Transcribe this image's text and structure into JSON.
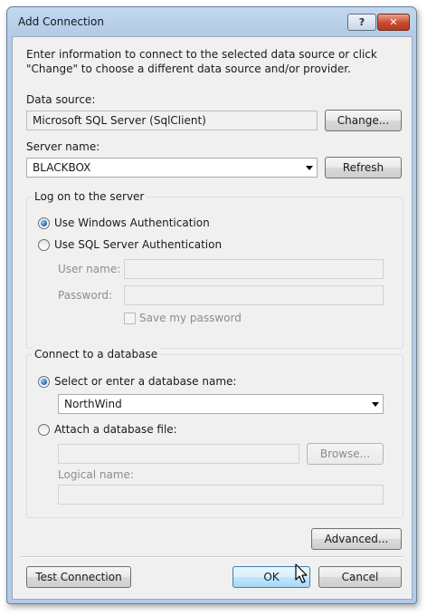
{
  "window": {
    "title": "Add Connection",
    "help_glyph": "?",
    "close_glyph": "✕"
  },
  "intro": "Enter information to connect to the selected data source or click \"Change\" to choose a different data source and/or provider.",
  "data_source": {
    "label": "Data source:",
    "value": "Microsoft SQL Server (SqlClient)",
    "change_button": "Change..."
  },
  "server": {
    "label": "Server name:",
    "value": "BLACKBOX",
    "refresh_button": "Refresh"
  },
  "logon": {
    "group_title": "Log on to the server",
    "windows_auth": "Use Windows Authentication",
    "sql_auth": "Use SQL Server Authentication",
    "selected": "windows",
    "user_label": "User name:",
    "user_value": "",
    "password_label": "Password:",
    "password_value": "",
    "save_password": "Save my password",
    "save_password_checked": false
  },
  "database": {
    "group_title": "Connect to a database",
    "select_label": "Select or enter a database name:",
    "db_value": "NorthWind",
    "attach_label": "Attach a database file:",
    "attach_value": "",
    "browse_button": "Browse...",
    "logical_label": "Logical name:",
    "logical_value": "",
    "selected": "select"
  },
  "buttons": {
    "advanced": "Advanced...",
    "test": "Test Connection",
    "ok": "OK",
    "cancel": "Cancel"
  },
  "icons": {
    "combo_arrow": "chevron-down-icon",
    "cursor": "mouse-pointer-icon"
  },
  "colors": {
    "title_bar": "#b3cbe6",
    "client_bg": "#f0f0f0",
    "ok_button": "#bee6fd",
    "close_button": "#c8492e"
  }
}
